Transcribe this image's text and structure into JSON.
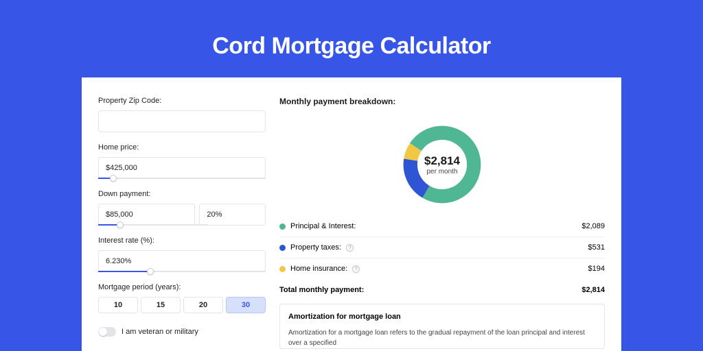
{
  "title": "Cord Mortgage Calculator",
  "form": {
    "zip_label": "Property Zip Code:",
    "zip_value": "",
    "home_price_label": "Home price:",
    "home_price_value": "$425,000",
    "home_price_slider_pct": 9,
    "down_payment_label": "Down payment:",
    "down_payment_value": "$85,000",
    "down_payment_pct_value": "20%",
    "down_payment_slider_pct": 20,
    "interest_label": "Interest rate (%):",
    "interest_value": "6.230%",
    "interest_slider_pct": 31,
    "period_label": "Mortgage period (years):",
    "periods": [
      "10",
      "15",
      "20",
      "30"
    ],
    "period_active": "30",
    "veteran_label": "I am veteran or military"
  },
  "breakdown": {
    "title": "Monthly payment breakdown:",
    "center_amount": "$2,814",
    "center_sub": "per month",
    "items": [
      {
        "label": "Principal & Interest:",
        "amount": "$2,089",
        "color": "#4fb793",
        "info": false
      },
      {
        "label": "Property taxes:",
        "amount": "$531",
        "color": "#2f55d4",
        "info": true
      },
      {
        "label": "Home insurance:",
        "amount": "$194",
        "color": "#f2c744",
        "info": true
      }
    ],
    "total_label": "Total monthly payment:",
    "total_amount": "$2,814"
  },
  "chart_data": {
    "type": "pie",
    "title": "Monthly payment breakdown",
    "series": [
      {
        "name": "Principal & Interest",
        "value": 2089,
        "color": "#4fb793"
      },
      {
        "name": "Property taxes",
        "value": 531,
        "color": "#2f55d4"
      },
      {
        "name": "Home insurance",
        "value": 194,
        "color": "#f2c744"
      }
    ],
    "total": 2814,
    "center_label": "$2,814 per month"
  },
  "amort": {
    "title": "Amortization for mortgage loan",
    "text": "Amortization for a mortgage loan refers to the gradual repayment of the loan principal and interest over a specified"
  }
}
